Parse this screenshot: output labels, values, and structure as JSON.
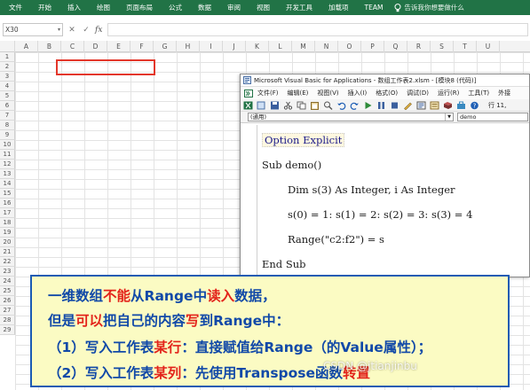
{
  "ribbon": {
    "tabs": [
      "文件",
      "开始",
      "插入",
      "绘图",
      "页面布局",
      "公式",
      "数据",
      "审阅",
      "视图",
      "开发工具",
      "加载项",
      "TEAM"
    ],
    "tell_me": "告诉我你想要做什么",
    "color": "#217346"
  },
  "formula_bar": {
    "name_box": "X30",
    "cancel": "✕",
    "enter": "✓",
    "fx": "fx",
    "value": ""
  },
  "sheet": {
    "columns": [
      "A",
      "B",
      "C",
      "D",
      "E",
      "F",
      "G",
      "H",
      "I",
      "J",
      "K",
      "L",
      "M",
      "N",
      "O",
      "P",
      "Q",
      "R",
      "S",
      "T",
      "U"
    ],
    "rows": [
      "1",
      "2",
      "3",
      "4",
      "5",
      "6",
      "7",
      "8",
      "9",
      "10",
      "11",
      "12",
      "13",
      "14",
      "15",
      "16",
      "17",
      "18",
      "19",
      "20",
      "21",
      "22",
      "23",
      "24",
      "25",
      "26",
      "27",
      "28",
      "29"
    ],
    "highlight_color": "#e3362a"
  },
  "vba_window": {
    "title": "Microsoft Visual Basic for Applications - 数组工作表2.xlsm - [模块8 (代码)]",
    "menu": [
      "文件(F)",
      "编辑(E)",
      "视图(V)",
      "插入(I)",
      "格式(O)",
      "调试(D)",
      "运行(R)",
      "工具(T)",
      "外接"
    ],
    "position": "行 11,",
    "object_combo": "(通用)",
    "proc_combo": "demo",
    "code": [
      "Option Explicit",
      "Sub demo()",
      "Dim s(3) As Integer, i As Integer",
      "s(0) = 1: s(1) = 2: s(2) = 3: s(3) = 4",
      "Range(\"c2:f2\") = s",
      "End Sub"
    ]
  },
  "caption": {
    "line1": {
      "a": "一维数组",
      "b": "不能",
      "c": "从Range中",
      "d": "读入",
      "e": "数据，"
    },
    "line2": {
      "a": "但是",
      "b": "可以",
      "c": "把自己的内容",
      "d": "写",
      "e": "到Range中："
    },
    "line3": {
      "a": "（1）写入工作表",
      "b": "某行",
      "c": "：直接赋值给Range（的Value属性）；"
    },
    "line4": {
      "a": "（2）写入工作表",
      "b": "某列",
      "c": "：先使用Transpose函数",
      "d": "转置"
    },
    "border_color": "#1b5bb3",
    "background": "#fbfbc3"
  },
  "watermark": "CSDN @jtianjinbu"
}
